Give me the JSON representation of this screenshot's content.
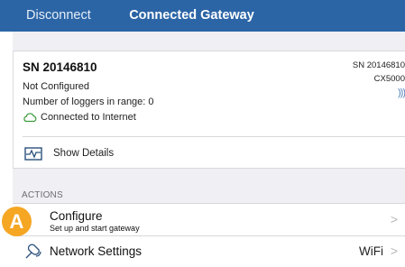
{
  "navbar": {
    "left_button": "Disconnect",
    "title": "Connected Gateway"
  },
  "device": {
    "serial_title": "SN 20146810",
    "status": "Not Configured",
    "loggers_in_range": "Number of loggers in range: 0",
    "internet_status": "Connected to Internet",
    "right_serial": "SN 20146810",
    "model": "CX5000",
    "signal_icon": "wifi-signal-icon"
  },
  "details": {
    "label": "Show Details",
    "icon": "chart-icon"
  },
  "actions": {
    "section_header": "ACTIONS",
    "configure_label": "Configure",
    "configure_sub": "Set up and start gateway",
    "network_label": "Network Settings",
    "network_value": "WiFi",
    "chevron": ">"
  },
  "callout": {
    "letter": "A",
    "color": "#f5a623"
  },
  "colors": {
    "navbar": "#2b65a6",
    "section_bg": "#efeff4",
    "accent": "#4d7fb8"
  }
}
